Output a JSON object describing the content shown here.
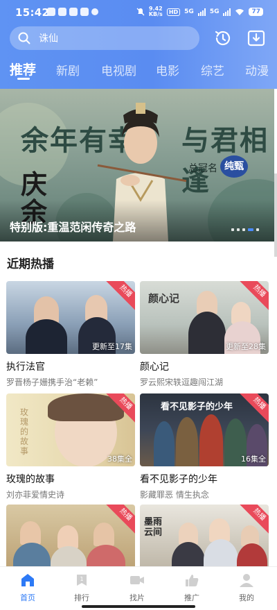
{
  "status_bar": {
    "time": "15:42",
    "net_speed_value": "9.42",
    "net_speed_unit": "KB/s",
    "hd_label": "HD",
    "sim1": "5G",
    "sim2": "5G",
    "battery": "77"
  },
  "search": {
    "placeholder": "诛仙"
  },
  "header_icons": [
    "history-icon",
    "download-icon"
  ],
  "tabs": [
    {
      "label": "推荐",
      "active": true
    },
    {
      "label": "新剧",
      "active": false
    },
    {
      "label": "电视剧",
      "active": false
    },
    {
      "label": "电影",
      "active": false
    },
    {
      "label": "综艺",
      "active": false
    },
    {
      "label": "动漫",
      "active": false
    }
  ],
  "banner": {
    "caption": "特别版:重温范闲传奇之路",
    "art_text_left": "余年有幸",
    "art_text_right": "与君相逢",
    "art_seal": "庆余年",
    "sponsor_label": "总冠名",
    "sponsor_brand": "纯甄",
    "slide_count": 5,
    "active_slide": 4
  },
  "section": {
    "title": "近期热播",
    "cards": [
      {
        "title": "执行法官",
        "subtitle": "罗晋杨子姗携手治“老赖”",
        "badge": "热播",
        "episodes": "更新至17集"
      },
      {
        "title": "颜心记",
        "subtitle": "罗云熙宋轶逗趣闯江湖",
        "badge": "热播",
        "episodes": "更新至28集"
      },
      {
        "title": "玫瑰的故事",
        "subtitle": "刘亦菲爱情史诗",
        "badge": "热播",
        "episodes": "38集全"
      },
      {
        "title": "看不见影子的少年",
        "subtitle": "影藏罪恶 情生执念",
        "badge": "热播",
        "episodes": "16集全"
      },
      {
        "title": "",
        "subtitle": "",
        "badge": "热播",
        "episodes": ""
      },
      {
        "title": "",
        "subtitle": "",
        "badge": "热播",
        "episodes": ""
      }
    ]
  },
  "bottom_nav": [
    {
      "label": "首页",
      "icon": "home-icon",
      "active": true
    },
    {
      "label": "排行",
      "icon": "ranking-icon",
      "active": false
    },
    {
      "label": "找片",
      "icon": "video-camera-icon",
      "active": false
    },
    {
      "label": "推广",
      "icon": "thumbs-up-icon",
      "active": false
    },
    {
      "label": "我的",
      "icon": "profile-icon",
      "active": false
    }
  ],
  "colors": {
    "accent": "#2d7af6",
    "header": "#5a8cf1",
    "hot_badge": "#e94a5a"
  }
}
